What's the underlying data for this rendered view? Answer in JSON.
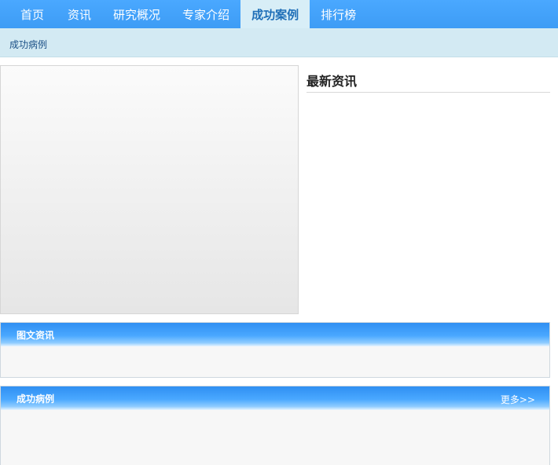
{
  "nav": {
    "tabs": [
      {
        "label": "首页",
        "active": false
      },
      {
        "label": "资讯",
        "active": false
      },
      {
        "label": "研究概况",
        "active": false
      },
      {
        "label": "专家介绍",
        "active": false
      },
      {
        "label": "成功案例",
        "active": true
      },
      {
        "label": "排行榜",
        "active": false
      }
    ]
  },
  "breadcrumb": {
    "label": "成功病例"
  },
  "latest_news": {
    "title": "最新资讯"
  },
  "panels": {
    "photo_news": {
      "title": "图文资讯"
    },
    "success_cases": {
      "title": "成功病例",
      "more_label": "更多>>"
    }
  },
  "colors": {
    "nav_blue": "#4aa8ff",
    "active_tab_bg": "#d8eef7",
    "breadcrumb_bg": "#d3eaf3"
  }
}
